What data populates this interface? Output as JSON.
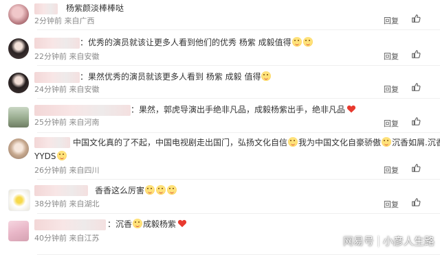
{
  "comments": [
    {
      "text": "杨紫颜淡棒棒哒",
      "time": "2分钟前",
      "source": "来自广西"
    },
    {
      "text": "：优秀的演员就该让更多人看到他们的优秀 杨紫 成毅值得",
      "time": "22分钟前",
      "source": "来自安徽"
    },
    {
      "text": "：果然优秀的演员就该更多人看到 杨紫 成毅 值得",
      "time": "24分钟前",
      "source": "来自安徽"
    },
    {
      "text": "：果然，郭虎导演出手绝非凡品，成毅杨紫出手，绝非凡品",
      "time": "25分钟前",
      "source": "来自河南"
    },
    {
      "text": "中国文化真的了不起，中国电视剧走出国门，弘扬文化自信",
      "text_b": "我为中国文化自豪骄傲",
      "text_c": "沉香如屑.沉香重华",
      "text2": "YYDS",
      "time": "26分钟前",
      "source": "来自四川"
    },
    {
      "text": "香香这么厉害",
      "time": "38分钟前",
      "source": "来自湖北"
    },
    {
      "text": "：沉香",
      "text_b": "成毅杨紫",
      "time": "40分钟前",
      "source": "来自江苏"
    }
  ],
  "actions": {
    "reply": "回复",
    "like_icon": "thumbs-up-icon"
  },
  "colors": {
    "heart": "#e83a2f",
    "emoji": "#f4b52c",
    "meta": "#8a8a8a"
  },
  "watermark": {
    "brand": "网易号",
    "author": "小彦人生路"
  }
}
